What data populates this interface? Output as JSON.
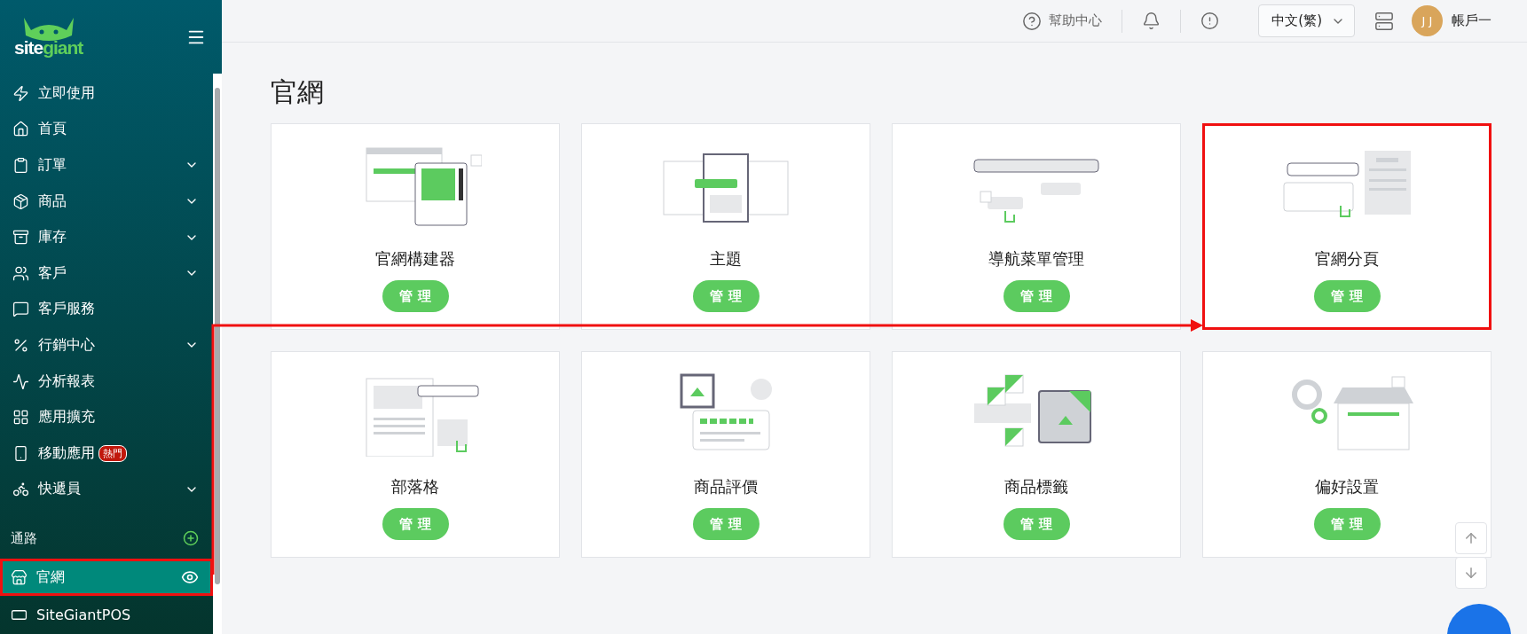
{
  "logo": {
    "part_1": "site",
    "part_2": "giant"
  },
  "sidebar": {
    "items": [
      {
        "label": "立即使用",
        "expandable": false
      },
      {
        "label": "首頁",
        "expandable": false
      },
      {
        "label": "訂單",
        "expandable": true
      },
      {
        "label": "商品",
        "expandable": true
      },
      {
        "label": "庫存",
        "expandable": true
      },
      {
        "label": "客戶",
        "expandable": true
      },
      {
        "label": "客戶服務",
        "expandable": false
      },
      {
        "label": "行銷中心",
        "expandable": true
      },
      {
        "label": "分析報表",
        "expandable": false
      },
      {
        "label": "應用擴充",
        "expandable": false
      },
      {
        "label": "移動應用",
        "expandable": false,
        "badge": "熱門"
      },
      {
        "label": "快遞員",
        "expandable": true
      }
    ],
    "channels": {
      "heading": "通路",
      "items": [
        {
          "label": "官網",
          "selected": true,
          "highlighted": true
        },
        {
          "label": "SiteGiantPOS",
          "selected": false,
          "highlighted": false
        }
      ]
    }
  },
  "top_bar": {
    "help": "幫助中心",
    "language": "中文(繁)",
    "avatar": "J J",
    "user": "帳戶一"
  },
  "page_title": "官網",
  "cards": [
    {
      "title": "官網構建器",
      "button": "管 理",
      "highlighted": false
    },
    {
      "title": "主題",
      "button": "管 理",
      "highlighted": false
    },
    {
      "title": "導航菜單管理",
      "button": "管 理",
      "highlighted": false
    },
    {
      "title": "官網分頁",
      "button": "管 理",
      "highlighted": true
    },
    {
      "title": "部落格",
      "button": "管 理",
      "highlighted": false
    },
    {
      "title": "商品評價",
      "button": "管 理",
      "highlighted": false
    },
    {
      "title": "商品標籤",
      "button": "管 理",
      "highlighted": false
    },
    {
      "title": "偏好設置",
      "button": "管 理",
      "highlighted": false
    }
  ]
}
